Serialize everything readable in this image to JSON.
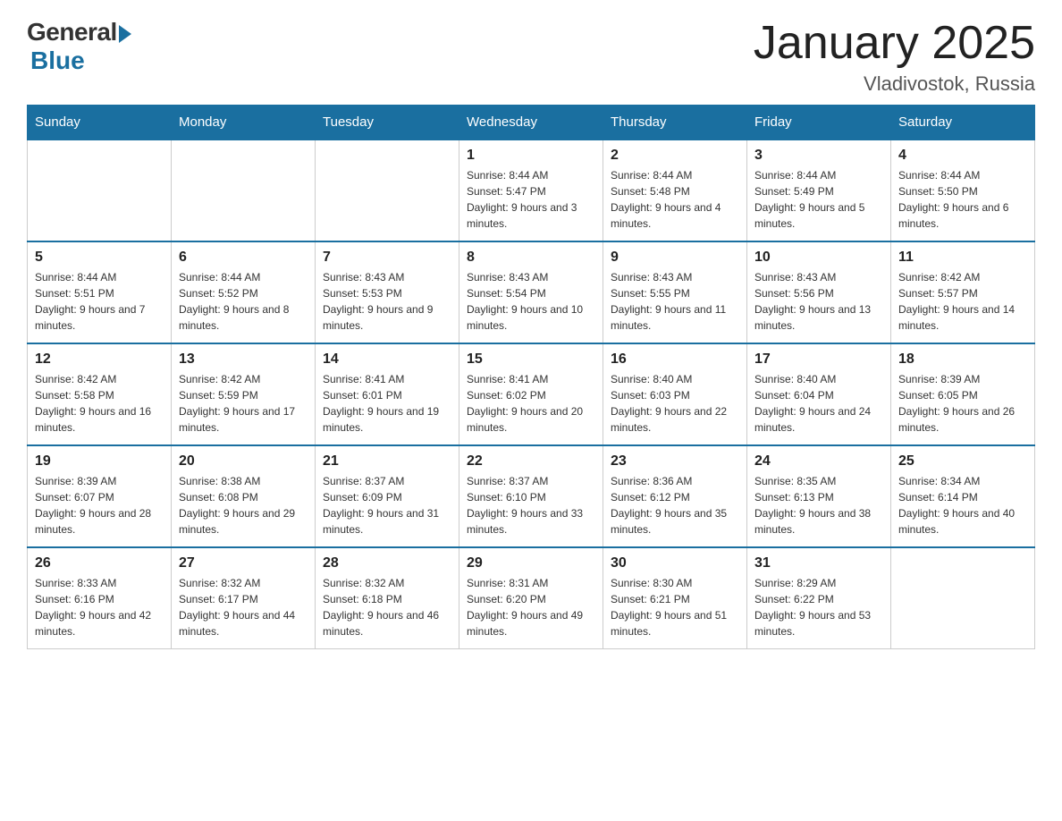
{
  "logo": {
    "general": "General",
    "blue": "Blue"
  },
  "title": "January 2025",
  "location": "Vladivostok, Russia",
  "days_header": [
    "Sunday",
    "Monday",
    "Tuesday",
    "Wednesday",
    "Thursday",
    "Friday",
    "Saturday"
  ],
  "weeks": [
    [
      {
        "day": "",
        "info": ""
      },
      {
        "day": "",
        "info": ""
      },
      {
        "day": "",
        "info": ""
      },
      {
        "day": "1",
        "info": "Sunrise: 8:44 AM\nSunset: 5:47 PM\nDaylight: 9 hours and 3 minutes."
      },
      {
        "day": "2",
        "info": "Sunrise: 8:44 AM\nSunset: 5:48 PM\nDaylight: 9 hours and 4 minutes."
      },
      {
        "day": "3",
        "info": "Sunrise: 8:44 AM\nSunset: 5:49 PM\nDaylight: 9 hours and 5 minutes."
      },
      {
        "day": "4",
        "info": "Sunrise: 8:44 AM\nSunset: 5:50 PM\nDaylight: 9 hours and 6 minutes."
      }
    ],
    [
      {
        "day": "5",
        "info": "Sunrise: 8:44 AM\nSunset: 5:51 PM\nDaylight: 9 hours and 7 minutes."
      },
      {
        "day": "6",
        "info": "Sunrise: 8:44 AM\nSunset: 5:52 PM\nDaylight: 9 hours and 8 minutes."
      },
      {
        "day": "7",
        "info": "Sunrise: 8:43 AM\nSunset: 5:53 PM\nDaylight: 9 hours and 9 minutes."
      },
      {
        "day": "8",
        "info": "Sunrise: 8:43 AM\nSunset: 5:54 PM\nDaylight: 9 hours and 10 minutes."
      },
      {
        "day": "9",
        "info": "Sunrise: 8:43 AM\nSunset: 5:55 PM\nDaylight: 9 hours and 11 minutes."
      },
      {
        "day": "10",
        "info": "Sunrise: 8:43 AM\nSunset: 5:56 PM\nDaylight: 9 hours and 13 minutes."
      },
      {
        "day": "11",
        "info": "Sunrise: 8:42 AM\nSunset: 5:57 PM\nDaylight: 9 hours and 14 minutes."
      }
    ],
    [
      {
        "day": "12",
        "info": "Sunrise: 8:42 AM\nSunset: 5:58 PM\nDaylight: 9 hours and 16 minutes."
      },
      {
        "day": "13",
        "info": "Sunrise: 8:42 AM\nSunset: 5:59 PM\nDaylight: 9 hours and 17 minutes."
      },
      {
        "day": "14",
        "info": "Sunrise: 8:41 AM\nSunset: 6:01 PM\nDaylight: 9 hours and 19 minutes."
      },
      {
        "day": "15",
        "info": "Sunrise: 8:41 AM\nSunset: 6:02 PM\nDaylight: 9 hours and 20 minutes."
      },
      {
        "day": "16",
        "info": "Sunrise: 8:40 AM\nSunset: 6:03 PM\nDaylight: 9 hours and 22 minutes."
      },
      {
        "day": "17",
        "info": "Sunrise: 8:40 AM\nSunset: 6:04 PM\nDaylight: 9 hours and 24 minutes."
      },
      {
        "day": "18",
        "info": "Sunrise: 8:39 AM\nSunset: 6:05 PM\nDaylight: 9 hours and 26 minutes."
      }
    ],
    [
      {
        "day": "19",
        "info": "Sunrise: 8:39 AM\nSunset: 6:07 PM\nDaylight: 9 hours and 28 minutes."
      },
      {
        "day": "20",
        "info": "Sunrise: 8:38 AM\nSunset: 6:08 PM\nDaylight: 9 hours and 29 minutes."
      },
      {
        "day": "21",
        "info": "Sunrise: 8:37 AM\nSunset: 6:09 PM\nDaylight: 9 hours and 31 minutes."
      },
      {
        "day": "22",
        "info": "Sunrise: 8:37 AM\nSunset: 6:10 PM\nDaylight: 9 hours and 33 minutes."
      },
      {
        "day": "23",
        "info": "Sunrise: 8:36 AM\nSunset: 6:12 PM\nDaylight: 9 hours and 35 minutes."
      },
      {
        "day": "24",
        "info": "Sunrise: 8:35 AM\nSunset: 6:13 PM\nDaylight: 9 hours and 38 minutes."
      },
      {
        "day": "25",
        "info": "Sunrise: 8:34 AM\nSunset: 6:14 PM\nDaylight: 9 hours and 40 minutes."
      }
    ],
    [
      {
        "day": "26",
        "info": "Sunrise: 8:33 AM\nSunset: 6:16 PM\nDaylight: 9 hours and 42 minutes."
      },
      {
        "day": "27",
        "info": "Sunrise: 8:32 AM\nSunset: 6:17 PM\nDaylight: 9 hours and 44 minutes."
      },
      {
        "day": "28",
        "info": "Sunrise: 8:32 AM\nSunset: 6:18 PM\nDaylight: 9 hours and 46 minutes."
      },
      {
        "day": "29",
        "info": "Sunrise: 8:31 AM\nSunset: 6:20 PM\nDaylight: 9 hours and 49 minutes."
      },
      {
        "day": "30",
        "info": "Sunrise: 8:30 AM\nSunset: 6:21 PM\nDaylight: 9 hours and 51 minutes."
      },
      {
        "day": "31",
        "info": "Sunrise: 8:29 AM\nSunset: 6:22 PM\nDaylight: 9 hours and 53 minutes."
      },
      {
        "day": "",
        "info": ""
      }
    ]
  ]
}
